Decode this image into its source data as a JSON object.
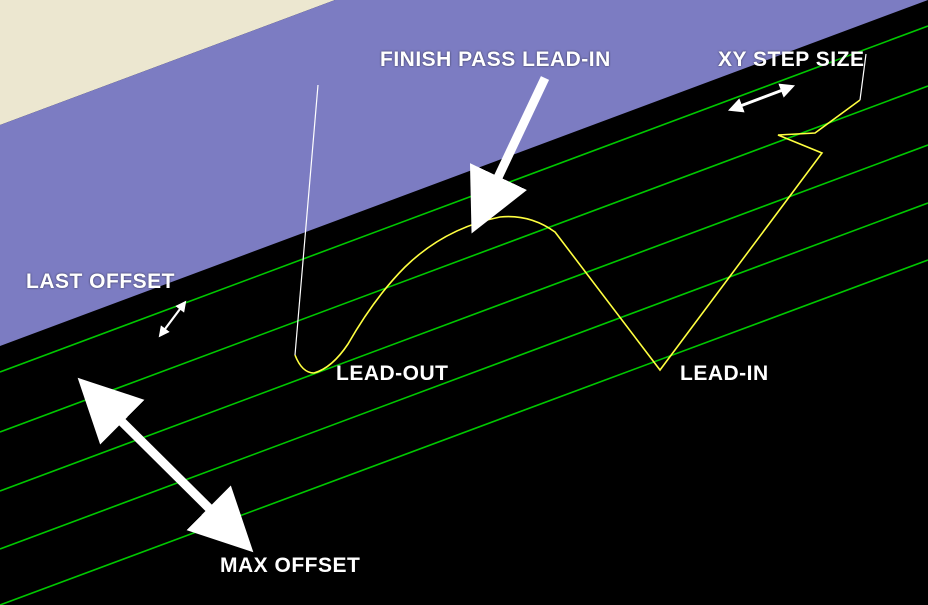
{
  "labels": {
    "finish_pass_lead_in": "FINISH PASS LEAD-IN",
    "xy_step_size": "XY STEP SIZE",
    "last_offset": "LAST OFFSET",
    "lead_out": "LEAD-OUT",
    "lead_in": "LEAD-IN",
    "max_offset": "MAX OFFSET"
  },
  "colors": {
    "surface_top": "#ece7d0",
    "surface_side": "#7c7cc2",
    "toolpath_offset": "#00c800",
    "toolpath_cut": "#ffff40",
    "rapid": "#ffffff",
    "annotation": "#ffffff",
    "background": "#000000"
  }
}
